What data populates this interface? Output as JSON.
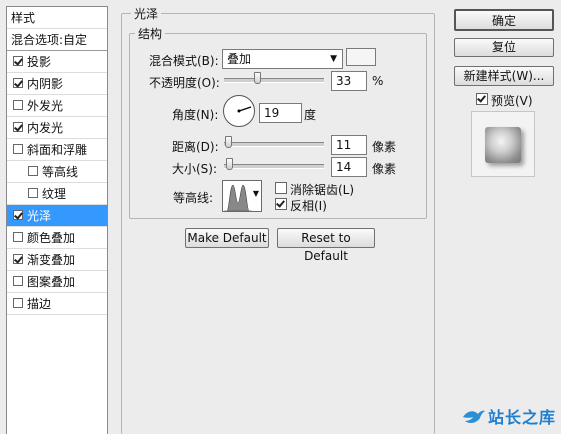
{
  "sidebar": {
    "items": [
      {
        "label": "样式",
        "kind": "header"
      },
      {
        "label": "混合选项:自定",
        "kind": "header"
      },
      {
        "label": "投影",
        "checked": true
      },
      {
        "label": "内阴影",
        "checked": true
      },
      {
        "label": "外发光",
        "checked": false
      },
      {
        "label": "内发光",
        "checked": true
      },
      {
        "label": "斜面和浮雕",
        "checked": false
      },
      {
        "label": "等高线",
        "checked": false,
        "indent": true
      },
      {
        "label": "纹理",
        "checked": false,
        "indent": true
      },
      {
        "label": "光泽",
        "checked": true,
        "selected": true
      },
      {
        "label": "颜色叠加",
        "checked": false
      },
      {
        "label": "渐变叠加",
        "checked": true
      },
      {
        "label": "图案叠加",
        "checked": false
      },
      {
        "label": "描边",
        "checked": false
      }
    ]
  },
  "satin": {
    "section_title": "光泽",
    "group_title": "结构",
    "blend_mode_label": "混合模式(B):",
    "blend_mode_value": "叠加",
    "opacity_label": "不透明度(O):",
    "opacity_value": "33",
    "opacity_unit": "%",
    "opacity_level": 0.33,
    "angle_label": "角度(N):",
    "angle_value": "19",
    "angle_unit": "度",
    "distance_label": "距离(D):",
    "distance_value": "11",
    "distance_unit": "像素",
    "distance_level": 0.04,
    "size_label": "大小(S):",
    "size_value": "14",
    "size_unit": "像素",
    "size_level": 0.05,
    "contour_label": "等高线:",
    "anti_alias_label": "消除锯齿(L)",
    "anti_alias_checked": false,
    "invert_label": "反相(I)",
    "invert_checked": true,
    "make_default_label": "Make Default",
    "reset_default_label": "Reset to Default"
  },
  "right": {
    "ok_label": "确定",
    "reset_label": "复位",
    "new_style_label": "新建样式(W)...",
    "preview_label": "预览(V)",
    "preview_checked": true
  },
  "watermark": "站长之库"
}
